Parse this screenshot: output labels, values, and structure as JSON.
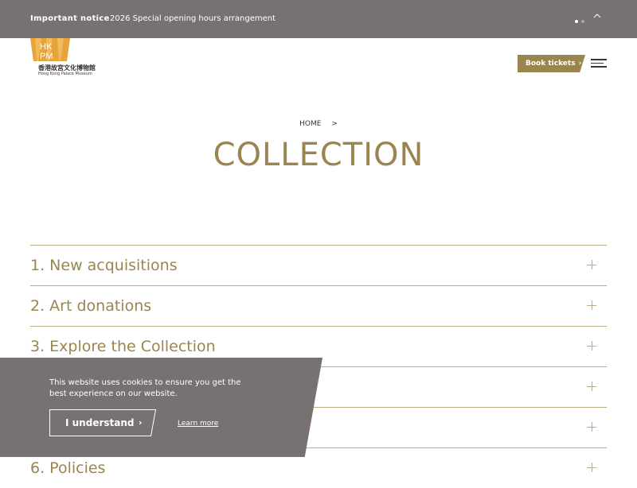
{
  "notice": {
    "label": "Important notice",
    "message": "2026 Special opening hours arrangement",
    "icons": {
      "pager": "pager-dots-icon",
      "collapse": "chevron-up-icon"
    }
  },
  "header": {
    "logo": {
      "mark": "HKPM",
      "zh": "香港故宮文化博物館",
      "en": "Hong Kong Palace Museum"
    },
    "book_label": "Book tickets",
    "book_icon": "chevron-right-icon",
    "menu_icon": "hamburger-menu-icon"
  },
  "breadcrumb": {
    "home": "HOME",
    "separator": ">"
  },
  "page_title": "COLLECTION",
  "accordion": {
    "items": [
      {
        "label": "1. New acquisitions"
      },
      {
        "label": "2. Art donations"
      },
      {
        "label": "3. Explore the Collection"
      },
      {
        "label": ""
      },
      {
        "label": ""
      },
      {
        "label": "6. Policies"
      }
    ],
    "expand_icon": "plus-icon"
  },
  "cookie": {
    "text": "This website uses cookies to ensure you get the best experience on our website.",
    "button_label": "I understand",
    "button_icon": "chevron-right-icon",
    "learn_more": "Learn more"
  },
  "colors": {
    "brand_gold": "#9a8550",
    "banner_gray": "#787172",
    "divider": "#b9ab82"
  }
}
